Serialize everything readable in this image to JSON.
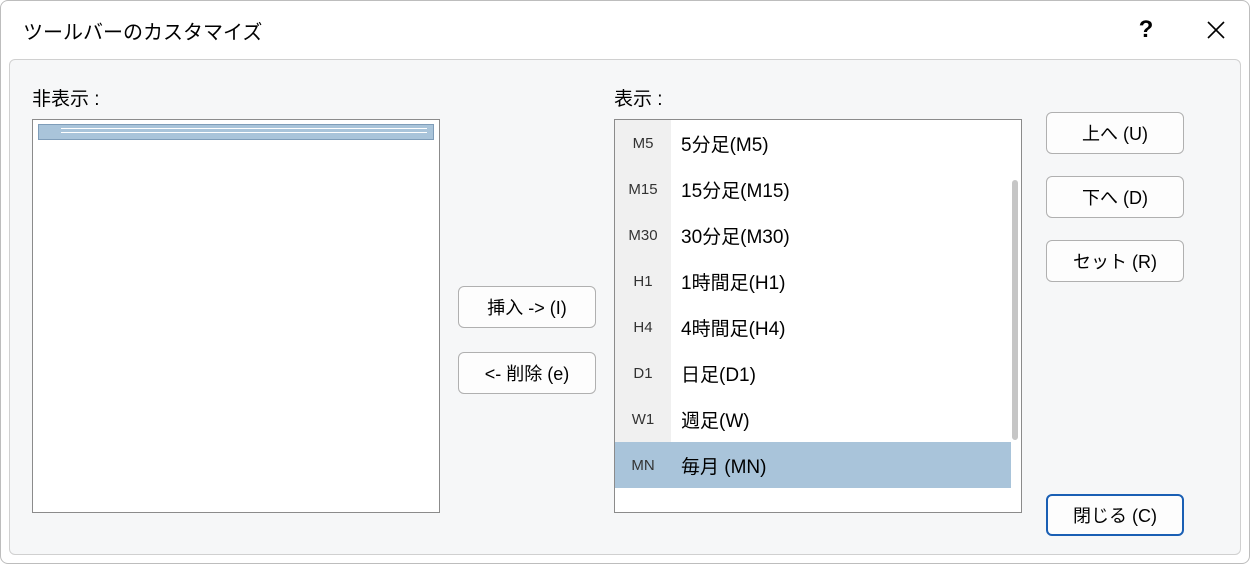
{
  "window": {
    "title": "ツールバーのカスタマイズ"
  },
  "labels": {
    "hidden": "非表示 :",
    "shown": "表示 :"
  },
  "buttons": {
    "insert": "挿入 -> (I)",
    "remove": "<- 削除 (e)",
    "up": "上へ (U)",
    "down": "下へ (D)",
    "set": "セット (R)",
    "close": "閉じる (C)"
  },
  "shown_items": [
    {
      "code": "M5",
      "text": "5分足(M5)"
    },
    {
      "code": "M15",
      "text": "15分足(M15)"
    },
    {
      "code": "M30",
      "text": "30分足(M30)"
    },
    {
      "code": "H1",
      "text": "1時間足(H1)"
    },
    {
      "code": "H4",
      "text": "4時間足(H4)"
    },
    {
      "code": "D1",
      "text": "日足(D1)"
    },
    {
      "code": "W1",
      "text": "週足(W)"
    },
    {
      "code": "MN",
      "text": "毎月 (MN)"
    }
  ],
  "selected_shown_index": 7
}
